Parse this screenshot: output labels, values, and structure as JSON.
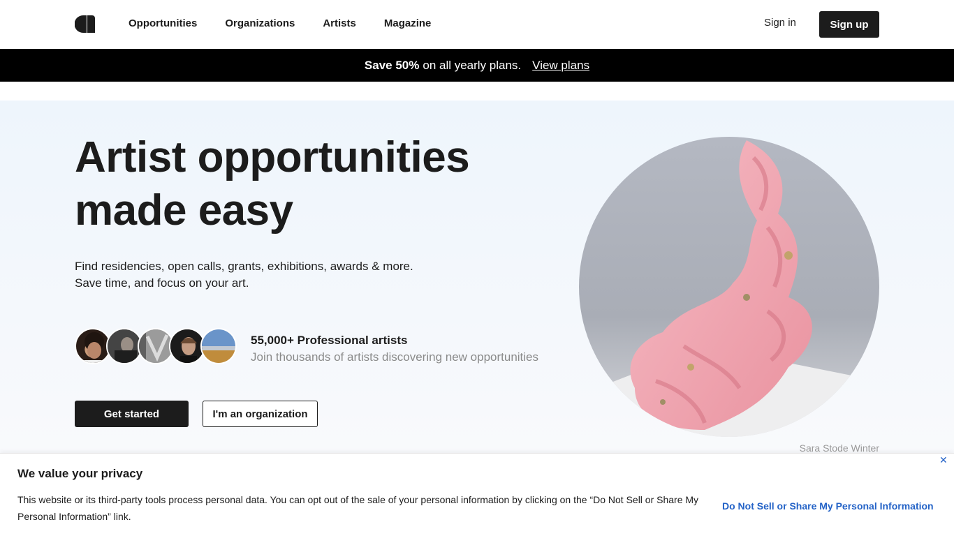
{
  "nav": {
    "logo": "logo-icon",
    "links": [
      "Opportunities",
      "Organizations",
      "Artists",
      "Magazine"
    ],
    "signin": "Sign in",
    "signup": "Sign up"
  },
  "promo": {
    "bold": "Save 50%",
    "text": "on all yearly plans.",
    "link": "View plans"
  },
  "hero": {
    "headline_line1": "Artist opportunities",
    "headline_line2": "made easy",
    "sub_line1": "Find residencies, open calls, grants, exhibitions, awards & more.",
    "sub_line2": "Save time, and focus on your art.",
    "stat_title": "55,000+ Professional artists",
    "stat_sub": "Join thousands of artists discovering new opportunities",
    "cta_primary": "Get started",
    "cta_secondary": "I'm an organization",
    "credit": "Sara Stode Winter"
  },
  "privacy": {
    "title": "We value your privacy",
    "text": "This website or its third-party tools process personal data. You can opt out of the sale of your personal information by clicking on the “Do Not Sell or Share My Personal Information” link.",
    "link": "Do Not Sell or Share My Personal Information",
    "close_icon": "close-icon"
  },
  "colors": {
    "dark": "#1c1c1c",
    "promo_bg": "#000000",
    "hero_bg": "#eef5fc",
    "link_blue": "#2463c7",
    "artwork_pink": "#f0a9b5"
  }
}
